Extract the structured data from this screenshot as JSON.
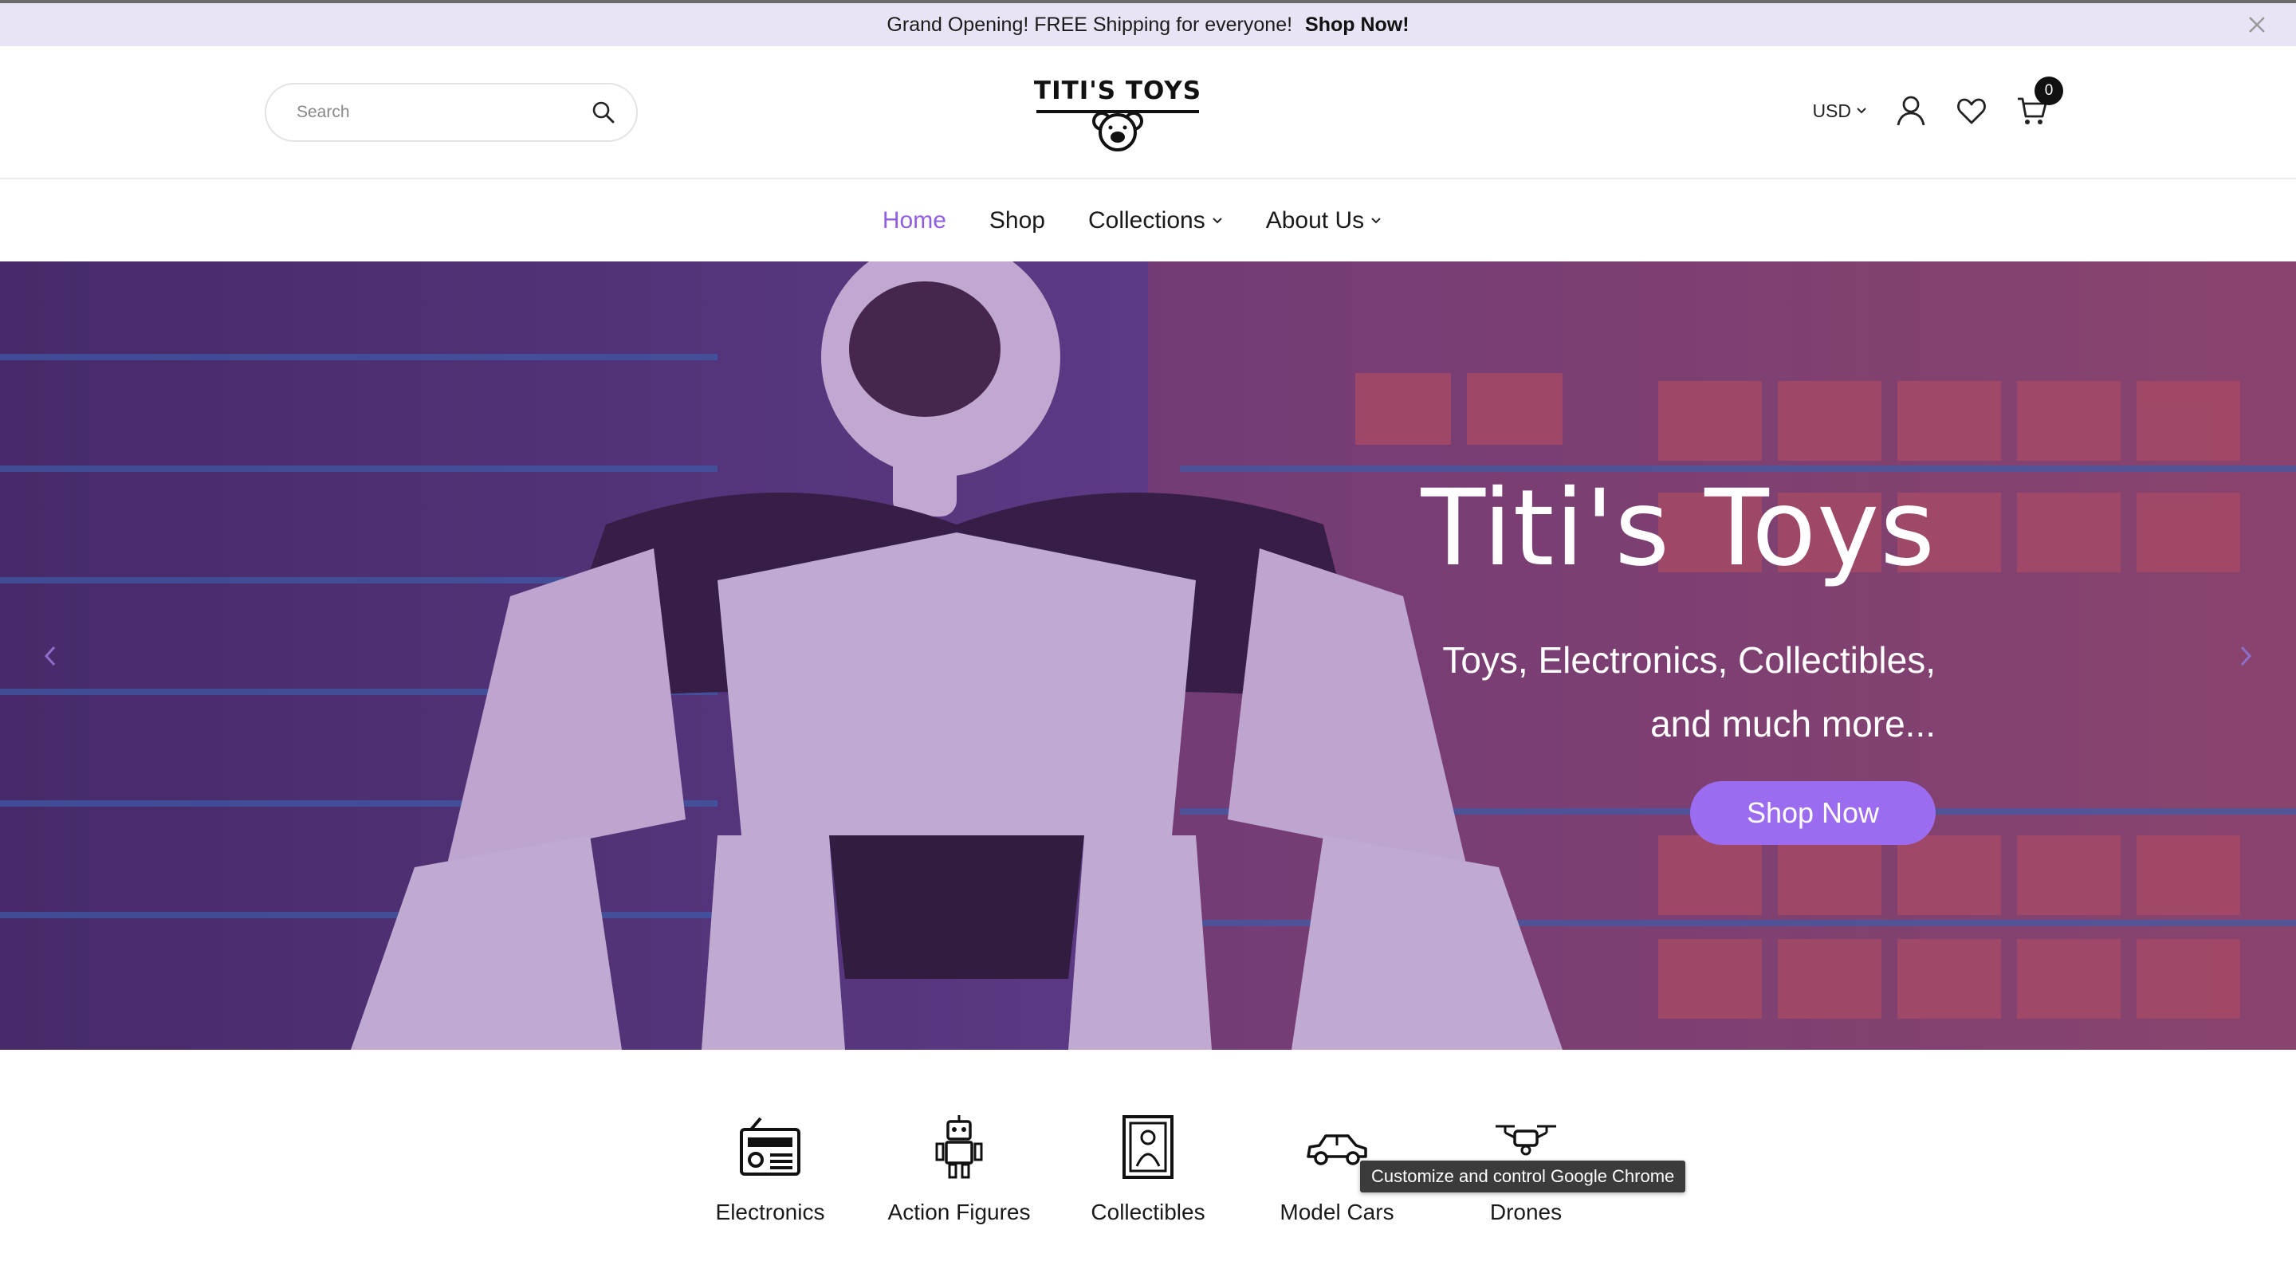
{
  "announcement": {
    "message": "Grand Opening! FREE Shipping for everyone!",
    "cta": "Shop Now!",
    "close_icon": "close-icon"
  },
  "header": {
    "search": {
      "placeholder": "Search",
      "value": "",
      "icon": "search-icon"
    },
    "logo": {
      "brand": "TITI'S TOYS",
      "mark": "teddy-bear-icon"
    },
    "currency": "USD",
    "account_icon": "user-icon",
    "wishlist_icon": "heart-icon",
    "cart_icon": "cart-icon",
    "cart_count": "0"
  },
  "nav": {
    "items": [
      {
        "label": "Home",
        "active": true
      },
      {
        "label": "Shop"
      },
      {
        "label": "Collections",
        "dropdown": true
      },
      {
        "label": "About Us",
        "dropdown": true
      }
    ],
    "accent": "#8f5fe0"
  },
  "hero": {
    "title": "Titi's Toys",
    "subtitle": "Toys, Electronics, Collectibles, and much more...",
    "button": "Shop Now",
    "button_color": "#9b6cf0"
  },
  "categories": [
    {
      "label": "Electronics",
      "icon": "radio-icon"
    },
    {
      "label": "Action Figures",
      "icon": "robot-icon"
    },
    {
      "label": "Collectibles",
      "icon": "framed-art-icon"
    },
    {
      "label": "Model Cars",
      "icon": "car-icon"
    },
    {
      "label": "Drones",
      "icon": "drone-icon"
    }
  ],
  "tooltip": "Customize and control Google Chrome"
}
